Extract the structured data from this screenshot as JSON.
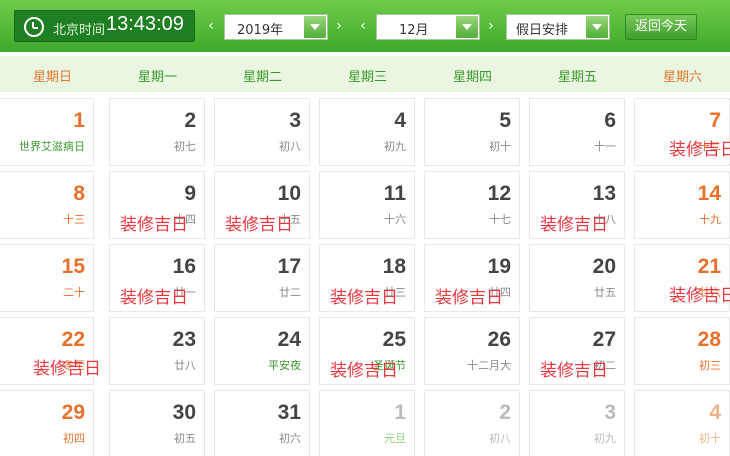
{
  "header": {
    "clock_label": "北京时间",
    "clock_time": "13:43:09",
    "year_value": "2019年",
    "month_value": "12月",
    "holiday_value": "假日安排",
    "today_label": "返回今天",
    "prev_arrow": "‹",
    "next_arrow": "›"
  },
  "weekdays": [
    "星期日",
    "星期一",
    "星期二",
    "星期三",
    "星期四",
    "星期五",
    "星期六"
  ],
  "days": [
    {
      "day": "1",
      "lunar": "世界艾滋病日",
      "festival": true,
      "weekend": true
    },
    {
      "day": "2",
      "lunar": "初七"
    },
    {
      "day": "3",
      "lunar": "初八"
    },
    {
      "day": "4",
      "lunar": "初九"
    },
    {
      "day": "5",
      "lunar": "初十"
    },
    {
      "day": "6",
      "lunar": "十一"
    },
    {
      "day": "7",
      "lunar": "十二",
      "weekend": true
    },
    {
      "day": "8",
      "lunar": "十三",
      "weekend": true
    },
    {
      "day": "9",
      "lunar": "十四"
    },
    {
      "day": "10",
      "lunar": "十五"
    },
    {
      "day": "11",
      "lunar": "十六"
    },
    {
      "day": "12",
      "lunar": "十七"
    },
    {
      "day": "13",
      "lunar": "十八"
    },
    {
      "day": "14",
      "lunar": "十九",
      "weekend": true
    },
    {
      "day": "15",
      "lunar": "二十",
      "weekend": true
    },
    {
      "day": "16",
      "lunar": "廿一"
    },
    {
      "day": "17",
      "lunar": "廿二"
    },
    {
      "day": "18",
      "lunar": "廿三"
    },
    {
      "day": "19",
      "lunar": "廿四"
    },
    {
      "day": "20",
      "lunar": "廿五"
    },
    {
      "day": "21",
      "lunar": "廿六",
      "weekend": true
    },
    {
      "day": "22",
      "lunar": "冬至",
      "weekend": true
    },
    {
      "day": "23",
      "lunar": "廿八"
    },
    {
      "day": "24",
      "lunar": "平安夜",
      "festival": true
    },
    {
      "day": "25",
      "lunar": "圣诞节",
      "festival": true
    },
    {
      "day": "26",
      "lunar": "十二月大"
    },
    {
      "day": "27",
      "lunar": "初二"
    },
    {
      "day": "28",
      "lunar": "初三",
      "weekend": true
    },
    {
      "day": "29",
      "lunar": "初四",
      "weekend": true
    },
    {
      "day": "30",
      "lunar": "初五"
    },
    {
      "day": "31",
      "lunar": "初六"
    },
    {
      "day": "1",
      "lunar": "元旦",
      "other": true,
      "festival": true
    },
    {
      "day": "2",
      "lunar": "初八",
      "other": true
    },
    {
      "day": "3",
      "lunar": "初九",
      "other": true
    },
    {
      "day": "4",
      "lunar": "初十",
      "other": true,
      "weekend": true
    }
  ],
  "stamp_text": "装修吉日",
  "stamp_days": [
    7,
    9,
    10,
    13,
    16,
    18,
    19,
    21,
    22,
    25,
    27
  ]
}
